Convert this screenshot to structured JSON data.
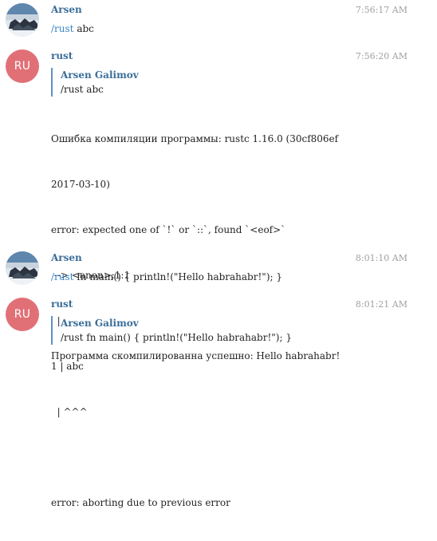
{
  "messages": [
    {
      "sender": "Arsen",
      "time": "7:56:17 AM",
      "command": "/rust",
      "text": "abc"
    },
    {
      "sender": "rust",
      "avatar_initials": "RU",
      "time": "7:56:20 AM",
      "reply_author": "Arsen Galimov",
      "reply_text": "/rust abc",
      "lines": [
        "Ошибка компиляции программы: rustc 1.16.0 (30cf806ef",
        "2017-03-10)",
        "error: expected one of `!` or `::`, found `<eof>`",
        " --> <anon>:1:1",
        "  |",
        "1 | abc",
        "  | ^^^",
        "",
        "error: aborting due to previous error"
      ]
    },
    {
      "sender": "Arsen",
      "time": "8:01:10 AM",
      "command": "/rust",
      "text": "fn main() { println!(\"Hello habrahabr!\"); }"
    },
    {
      "sender": "rust",
      "avatar_initials": "RU",
      "time": "8:01:21 AM",
      "reply_author": "Arsen Galimov",
      "reply_text": "/rust fn main() { println!(\"Hello habrahabr!\"); }",
      "text": "Программа скомпилированна успешно: Hello habrahabr!"
    }
  ],
  "colors": {
    "sender_name": "#3a6d99",
    "command_link": "#3a84c6",
    "reply_bar": "#5e93c7",
    "rust_avatar": "#e17076",
    "timestamp": "#a0a0a0"
  },
  "icons": {
    "user_avatar": "user-photo-avatar",
    "bot_avatar": "initials-avatar"
  }
}
